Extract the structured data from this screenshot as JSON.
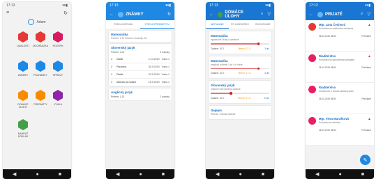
{
  "colors": {
    "home_bg": "#f2f2f2",
    "grades_bar": "#1e88e5",
    "homework_bar": "#1976d2",
    "received_bar": "#1976d2",
    "red": "#e53935",
    "blue": "#1e88e5",
    "green": "#43a047",
    "orange": "#fb8c00",
    "purple": "#8e24aa",
    "teal": "#00897b"
  },
  "status": {
    "time": "17:13",
    "icons": "▾▾▮"
  },
  "nav": {
    "back": "◀",
    "home": "●",
    "recent": "■"
  },
  "phone1": {
    "user": "Adam",
    "tiles": [
      {
        "label": "Udalosti",
        "color": "#e53935",
        "icon": "calendar-icon"
      },
      {
        "label": "Dochádzka",
        "color": "#e53935",
        "icon": "clock-icon"
      },
      {
        "label": "Rozvrh",
        "color": "#d81b60",
        "icon": "timetable-icon"
      },
      {
        "label": "Známky",
        "color": "#1e88e5",
        "icon": "grade-icon"
      },
      {
        "label": "Poznámky",
        "color": "#1e88e5",
        "icon": "note-icon"
      },
      {
        "label": "Správy",
        "color": "#1e88e5",
        "icon": "message-icon"
      },
      {
        "label": "Domáce úlohy",
        "color": "#fb8c00",
        "icon": "homework-icon"
      },
      {
        "label": "Predmety",
        "color": "#fb8c00",
        "icon": "subjects-icon"
      },
      {
        "label": "Výuka",
        "color": "#8e24aa",
        "icon": "lesson-icon"
      },
      {
        "label": "Nahrať doklad",
        "color": "#43a047",
        "icon": "upload-icon"
      }
    ]
  },
  "phone2": {
    "title": "ZNÁMKY",
    "tabs": [
      "Podľa dátumu",
      "Podľa predmetov"
    ],
    "summary": {
      "subject": "Matematika",
      "line": "Priemer: 2,31   Priemer x   Známky: 26"
    },
    "subject": {
      "name": "Slovenský jazyk",
      "avg": "Priemer: 2,03",
      "count": "3 známky"
    },
    "rows": [
      {
        "n": "4",
        "label": "Diktát",
        "date": "2.10.2019",
        "weight": "Váha 1"
      },
      {
        "n": "2",
        "label": "Písomka",
        "date": "30.9.2019",
        "weight": "Váha 1"
      },
      {
        "n": "1",
        "label": "Diktát",
        "date": "20.9.2019",
        "weight": "Váha 1"
      },
      {
        "n": "1",
        "label": "Aktivita na hodine",
        "date": "15.9.2019",
        "weight": "Váha 1"
      }
    ],
    "next": {
      "name": "Anglický jazyk",
      "avg": "Priemer: 1,33",
      "count": "2 známky"
    }
  },
  "phone3": {
    "title": "DOMÁCE ÚLOHY",
    "tabs": [
      "Aktuálne",
      "Po uzávierke",
      "Odovzdané"
    ],
    "cards": [
      {
        "subject": "Matematika",
        "desc": "vypracovať úlohy z učebnice",
        "date": "Zadané: 10.3.",
        "due": "Termín: 17.3.",
        "days": "3 dni",
        "progress": 0.82
      },
      {
        "subject": "Matematika",
        "desc": "prepísať cvičenie 1 až 4 v zošite",
        "date": "Zadané: 10.3.",
        "due": "Termín: 17.3.",
        "days": "3 dni",
        "progress": 0.82
      },
      {
        "subject": "Slovenský jazyk",
        "desc": "pripraviť sloh na tému vianoce",
        "date": "Zadané: 10.3.",
        "due": "Termín: 17.3.",
        "days": "5 dní",
        "progress": 0.35
      },
      {
        "subject": "Dejepis",
        "desc": "Referát - Rímska história",
        "date": "",
        "due": "",
        "days": "",
        "progress": 0
      }
    ]
  },
  "phone4": {
    "title": "PRIJATÉ",
    "items": [
      {
        "name": "Mgr. Jana Čechová",
        "desc": "Pozvánka na rodičovské združenie",
        "date": "26.10.2019 08:00",
        "state": "Prečítané",
        "alert": true,
        "avatar": "#e53935"
      },
      {
        "name": "Riaditeľstvo",
        "desc": "Pozvánka na spoločenské podujatie",
        "date": "26.10.2019 08:00",
        "state": "Prečítané",
        "alert": true,
        "avatar": "#e91e63"
      },
      {
        "name": "Riaditeľstvo",
        "desc": "Oznámenie o konaní školskej akcie",
        "date": "26.10.2019 08:00",
        "state": "Prečítané",
        "alert": false,
        "avatar": "#e91e63"
      },
      {
        "name": "Mgr. Viera Marušková",
        "desc": "Pozvánka na schôdzu",
        "date": "26.10.2019 08:00",
        "state": "Prečítané",
        "alert": true,
        "avatar": "#e91e63"
      }
    ]
  }
}
